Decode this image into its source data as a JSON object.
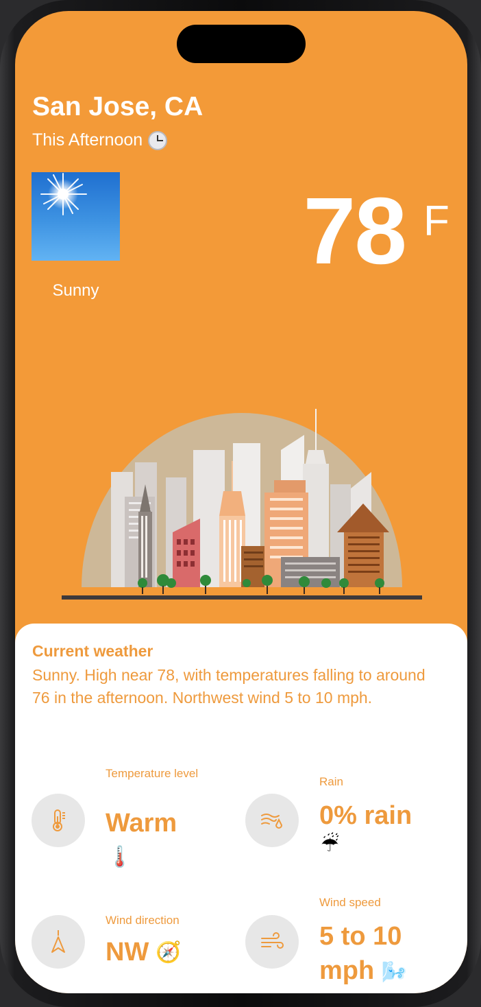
{
  "header": {
    "city": "San Jose, CA",
    "period": "This Afternoon",
    "period_icon": "clock-icon"
  },
  "current": {
    "condition": "Sunny",
    "condition_icon": "sun-icon",
    "temperature": "78",
    "unit": "F"
  },
  "illustration": "city-skyline",
  "details": {
    "title": "Current weather",
    "description": "Sunny. High near 78, with temperatures falling to around 76 in the afternoon. Northwest wind 5 to 10 mph."
  },
  "metrics": {
    "temperature_level": {
      "label": "Temperature level",
      "value": "Warm",
      "icon": "thermometer-icon",
      "emoji": "🌡️"
    },
    "rain": {
      "label": "Rain",
      "value": "0% rain",
      "icon": "raindrop-wind-icon",
      "emoji": "☔"
    },
    "wind_direction": {
      "label": "Wind direction",
      "value": "NW",
      "icon": "location-arrow-icon",
      "emoji": "🧭"
    },
    "wind_speed": {
      "label": "Wind speed",
      "value": "5 to 10 mph",
      "icon": "wind-icon",
      "emoji": "🌬️"
    }
  },
  "colors": {
    "accent": "#f39a38",
    "text_accent": "#ee9a3d",
    "sheet": "#ffffff",
    "circle": "#e7e7e7"
  }
}
